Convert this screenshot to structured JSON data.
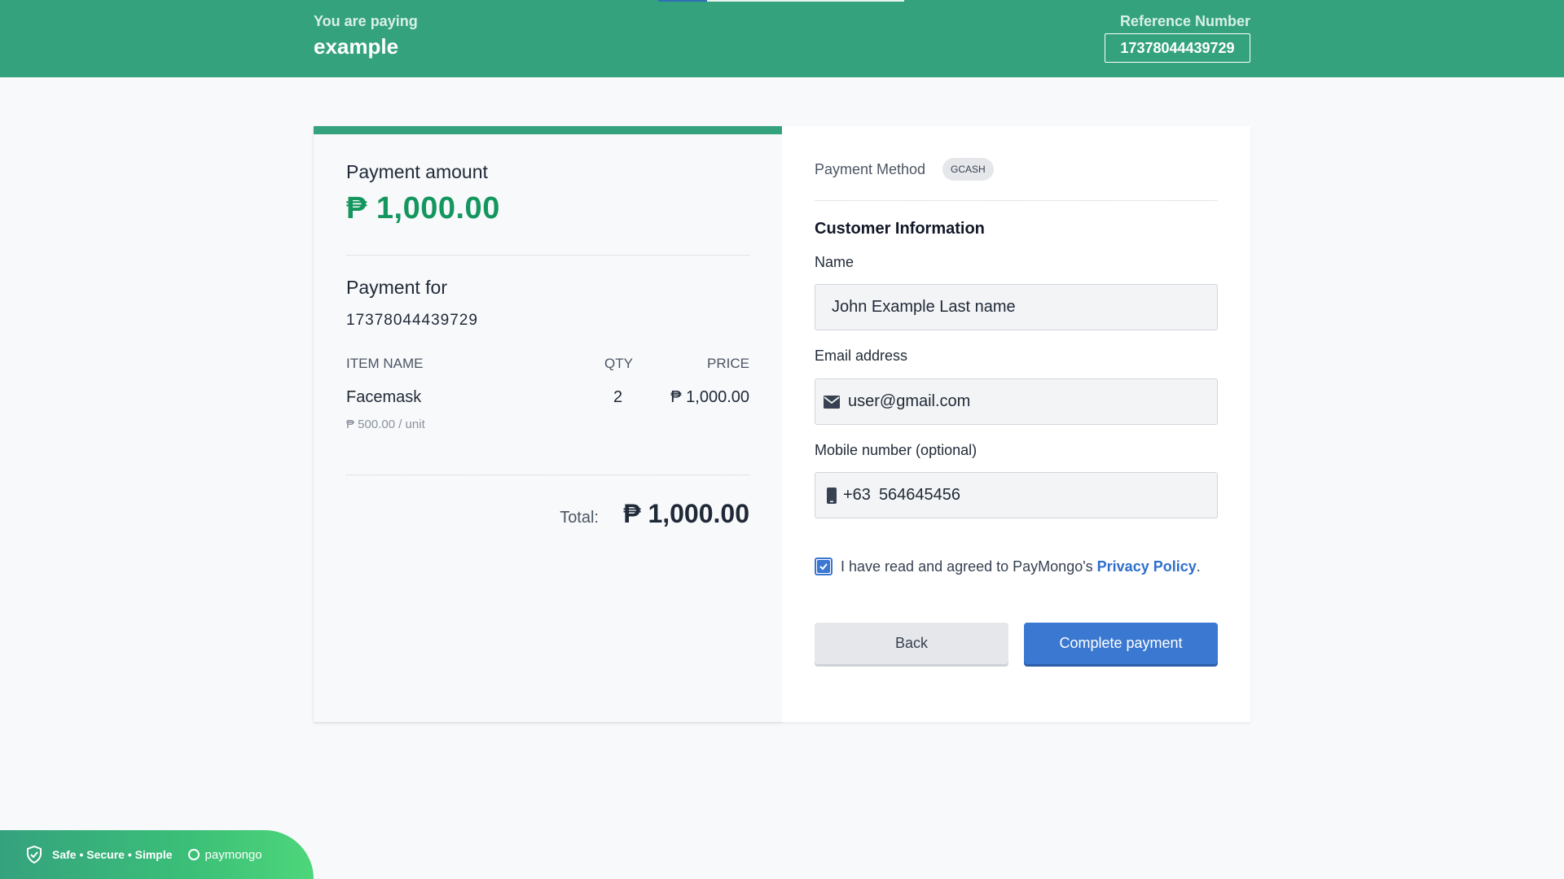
{
  "header": {
    "paying_label": "You are paying",
    "merchant": "example",
    "reference_label": "Reference Number",
    "reference_number": "17378044439729"
  },
  "summary": {
    "amount_label": "Payment amount",
    "amount": "₱ 1,000.00",
    "payment_for_label": "Payment for",
    "payment_for_value": "17378044439729",
    "columns": {
      "item": "ITEM NAME",
      "qty": "QTY",
      "price": "PRICE"
    },
    "items": [
      {
        "name": "Facemask",
        "qty": "2",
        "price": "₱ 1,000.00",
        "unit": "₱ 500.00 / unit"
      }
    ],
    "total_label": "Total:",
    "total": "₱ 1,000.00"
  },
  "form": {
    "payment_method_label": "Payment Method",
    "payment_method_badge": "GCASH",
    "customer_info_title": "Customer Information",
    "name_label": "Name",
    "name_value": "John Example Last name",
    "email_label": "Email address",
    "email_value": "user@gmail.com",
    "mobile_label": "Mobile number (optional)",
    "mobile_prefix": "+63",
    "mobile_value": "564645456",
    "consent_text": "I have read and agreed to PayMongo's ",
    "consent_link": "Privacy Policy",
    "consent_period": ".",
    "back_label": "Back",
    "pay_label": "Complete payment"
  },
  "footer": {
    "tagline": "Safe • Secure • Simple",
    "brand": "paymongo"
  },
  "colors": {
    "brand_green": "#35a27e",
    "amount_green": "#14965f",
    "primary_blue": "#3b78d1"
  }
}
